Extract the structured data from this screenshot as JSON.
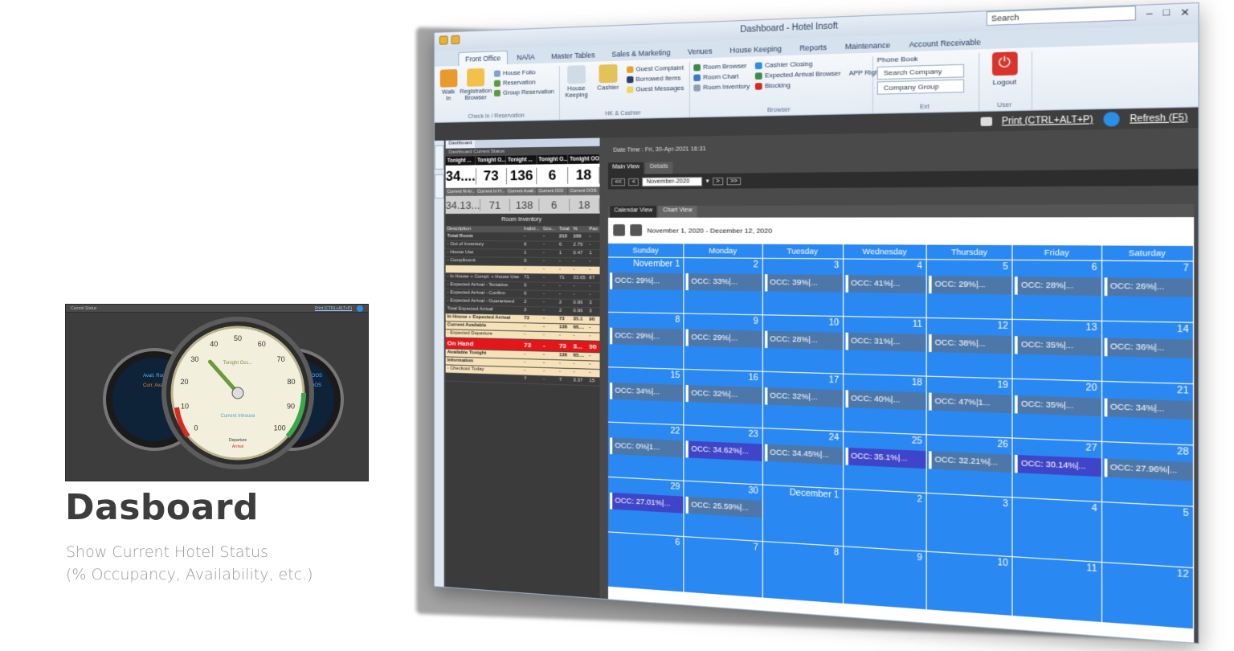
{
  "promo": {
    "title": "Dasboard",
    "subtitle_line1": "Show Current Hotel Status",
    "subtitle_line2": "(% Occupancy, Availability, etc.)"
  },
  "window": {
    "title": "Dashboard - Hotel Insoft",
    "search_placeholder": "Search",
    "tabs": [
      "Front Office",
      "NA/IA",
      "Master Tables",
      "Sales & Marketing",
      "Venues",
      "House Keeping",
      "Reports",
      "Maintenance",
      "Account Receivable"
    ],
    "ribbon": {
      "checkin_group": {
        "label": "Check in / Reservation",
        "walkin": "Walk In",
        "registration_browser": "Registration Browser",
        "house_folio": "House Folio",
        "reservation": "Reservation",
        "group_reservation": "Group Reservation"
      },
      "hk_group": {
        "label": "HK & Cashier",
        "house_keeping": "House Keeping",
        "cashier": "Cashier",
        "guest_complaint": "Guest Complaint",
        "borrowed_items": "Borrowed Items",
        "guest_messages": "Guest Messages"
      },
      "browser_group": {
        "label": "Browser",
        "room_browser": "Room Browser",
        "room_chart": "Room Chart",
        "room_inventory": "Room Inventory",
        "cashier_closing": "Cashier Closing",
        "expected_arrival_browser": "Expected Arrival Browser",
        "blocking": "Blocking",
        "app_right": "APP Right"
      },
      "ext_group": {
        "label": "Ext",
        "phone_book": "Phone Book",
        "search_company": "Search Company",
        "company_group": "Company Group"
      },
      "user_group": {
        "label": "User",
        "logout": "Logout"
      }
    }
  },
  "toolstrip": {
    "print": "Print (CTRL+ALT+P)",
    "refresh": "Refresh (F5)"
  },
  "left": {
    "doc_tab": "Dashboard",
    "subtab1": "Dashboard",
    "subtab2": "Current Status",
    "kpi_headers": [
      "Tonight ...",
      "Tonight O...",
      "Tonight ...",
      "Tonight O...",
      "Tonight OOS"
    ],
    "kpi_values": [
      "34....",
      "73",
      "136",
      "6",
      "18"
    ],
    "cur_headers": [
      "Current %-In...",
      "Current In H...",
      "Current Avail...",
      "Current OOI",
      "Current OOS"
    ],
    "cur_values": [
      "34.13...",
      "71",
      "138",
      "6",
      "18"
    ],
    "inventory_title": "Room Inventory",
    "inv_cols": [
      "Description",
      "Indivi...",
      "Gro...",
      "Total",
      "%",
      "Pax"
    ],
    "inv_rows": [
      {
        "d": "Total Room",
        "i": "-",
        "g": "-",
        "t": "215",
        "p": "100",
        "x": "-",
        "cls": "bold"
      },
      {
        "d": "- Out of Inventory",
        "i": "6",
        "g": "-",
        "t": "6",
        "p": "2.79",
        "x": "-",
        "cls": ""
      },
      {
        "d": "- House Use",
        "i": "1",
        "g": "-",
        "t": "1",
        "p": "0.47",
        "x": "1",
        "cls": ""
      },
      {
        "d": "- Compliment",
        "i": "0",
        "g": "-",
        "t": "-",
        "p": "-",
        "x": "-",
        "cls": ""
      },
      {
        "d": "",
        "i": "-",
        "g": "-",
        "t": "-",
        "p": "-",
        "x": "-",
        "cls": "hl"
      },
      {
        "d": "- In House + Compl. + House Use",
        "i": "71",
        "g": "-",
        "t": "71",
        "p": "33.65",
        "x": "87",
        "cls": ""
      },
      {
        "d": "- Expected Arrival - Tentative",
        "i": "0",
        "g": "-",
        "t": "-",
        "p": "-",
        "x": "-",
        "cls": ""
      },
      {
        "d": "- Expected Arrival - Confirm",
        "i": "0",
        "g": "-",
        "t": "-",
        "p": "-",
        "x": "-",
        "cls": ""
      },
      {
        "d": "- Expected Arrival - Guaranteed",
        "i": "2",
        "g": "-",
        "t": "2",
        "p": "0.96",
        "x": "3",
        "cls": ""
      },
      {
        "d": "Total Expected Arrival",
        "i": "2",
        "g": "-",
        "t": "2",
        "p": "0.96",
        "x": "3",
        "cls": ""
      },
      {
        "d": "In House + Expected Arrival",
        "i": "73",
        "g": "-",
        "t": "73",
        "p": "35.1",
        "x": "90",
        "cls": "hl bold"
      },
      {
        "d": "Current Available",
        "i": "-",
        "g": "-",
        "t": "138",
        "p": "66....",
        "x": "-",
        "cls": "hl bold"
      },
      {
        "d": "- Expected Departure",
        "i": "-",
        "g": "-",
        "t": "-",
        "p": "-",
        "x": "-",
        "cls": "hl"
      },
      {
        "d": "On Hand",
        "i": "73",
        "g": "-",
        "t": "73",
        "p": "3...",
        "x": "90",
        "cls": "red"
      },
      {
        "d": "Available Tonight",
        "i": "-",
        "g": "-",
        "t": "136",
        "p": "65....",
        "x": "-",
        "cls": "hl bold"
      },
      {
        "d": "Information",
        "i": "-",
        "g": "-",
        "t": "-",
        "p": "-",
        "x": "-",
        "cls": "hl bold"
      },
      {
        "d": "- Checkout Today",
        "i": "-",
        "g": "-",
        "t": "-",
        "p": "-",
        "x": "-",
        "cls": "hl"
      },
      {
        "d": "",
        "i": "7",
        "g": "-",
        "t": "7",
        "p": "3.37",
        "x": "15",
        "cls": ""
      }
    ]
  },
  "right": {
    "datetime": "Date Time :  Fri, 30-Apr-2021 16:31",
    "tabs": [
      "Main View",
      "Details"
    ],
    "nav_prev2": "<<",
    "nav_prev": "<",
    "month": "November-2020",
    "nav_next": ">",
    "nav_next2": ">>",
    "cal_tabs": [
      "Calendar View",
      "Chart View"
    ],
    "range": "November 1, 2020 - December 12, 2020",
    "days": [
      "Sunday",
      "Monday",
      "Tuesday",
      "Wednesday",
      "Thursday",
      "Friday",
      "Saturday"
    ],
    "cells": [
      {
        "day": "November 1",
        "occ": "OCC: 29%|..."
      },
      {
        "day": "2",
        "occ": "OCC: 33%|..."
      },
      {
        "day": "3",
        "occ": "OCC: 39%|..."
      },
      {
        "day": "4",
        "occ": "OCC: 41%|..."
      },
      {
        "day": "5",
        "occ": "OCC: 29%|..."
      },
      {
        "day": "6",
        "occ": "OCC: 28%|..."
      },
      {
        "day": "7",
        "occ": "OCC: 26%|..."
      },
      {
        "day": "8",
        "occ": "OCC: 29%|..."
      },
      {
        "day": "9",
        "occ": "OCC: 29%|..."
      },
      {
        "day": "10",
        "occ": "OCC: 28%|..."
      },
      {
        "day": "11",
        "occ": "OCC: 31%|..."
      },
      {
        "day": "12",
        "occ": "OCC: 38%|..."
      },
      {
        "day": "13",
        "occ": "OCC: 35%|..."
      },
      {
        "day": "14",
        "occ": "OCC: 36%|..."
      },
      {
        "day": "15",
        "occ": "OCC: 34%|..."
      },
      {
        "day": "16",
        "occ": "OCC: 32%|..."
      },
      {
        "day": "17",
        "occ": "OCC: 32%|..."
      },
      {
        "day": "18",
        "occ": "OCC: 40%|..."
      },
      {
        "day": "19",
        "occ": "OCC: 47%|1..."
      },
      {
        "day": "20",
        "occ": "OCC: 35%|..."
      },
      {
        "day": "21",
        "occ": "OCC: 34%|..."
      },
      {
        "day": "22",
        "occ": "OCC: 0%|1..."
      },
      {
        "day": "23",
        "occ": "OCC: 34.62%|..."
      },
      {
        "day": "24",
        "occ": "OCC: 34.45%|..."
      },
      {
        "day": "25",
        "occ": "OCC: 35.1%|..."
      },
      {
        "day": "26",
        "occ": "OCC: 32.21%|..."
      },
      {
        "day": "27",
        "occ": "OCC: 30.14%|..."
      },
      {
        "day": "28",
        "occ": "OCC: 27.96%|..."
      },
      {
        "day": "29",
        "occ": "OCC: 27.01%|..."
      },
      {
        "day": "30",
        "occ": "OCC: 25.59%|..."
      },
      {
        "day": "December 1",
        "occ": ""
      },
      {
        "day": "2",
        "occ": ""
      },
      {
        "day": "3",
        "occ": ""
      },
      {
        "day": "4",
        "occ": ""
      },
      {
        "day": "5",
        "occ": ""
      },
      {
        "day": "6",
        "occ": ""
      },
      {
        "day": "7",
        "occ": ""
      },
      {
        "day": "8",
        "occ": ""
      },
      {
        "day": "9",
        "occ": ""
      },
      {
        "day": "10",
        "occ": ""
      },
      {
        "day": "11",
        "occ": ""
      },
      {
        "day": "12",
        "occ": ""
      }
    ]
  },
  "gauge": {
    "topbar": "Current Status",
    "link": "Print (CTRL+ALT+P)",
    "center_label": "Tonight Occ...",
    "bottom_label": "Current Inhouse",
    "arrival_label": "Departure",
    "arrival_sub": "Arrival",
    "left_label1": "Avail. Room",
    "left_label2": "Curr. Avail.",
    "right_label1": "Night OOS",
    "right_label2": "Curr. OOS",
    "scale": [
      "0",
      "10",
      "20",
      "30",
      "40",
      "50",
      "60",
      "70",
      "80",
      "90",
      "100"
    ],
    "value_pct": 34
  },
  "colors": {
    "calendar_blue": "#2a88f2",
    "occ_bar": "#4d77a8",
    "on_hand_red": "#e5161a"
  }
}
